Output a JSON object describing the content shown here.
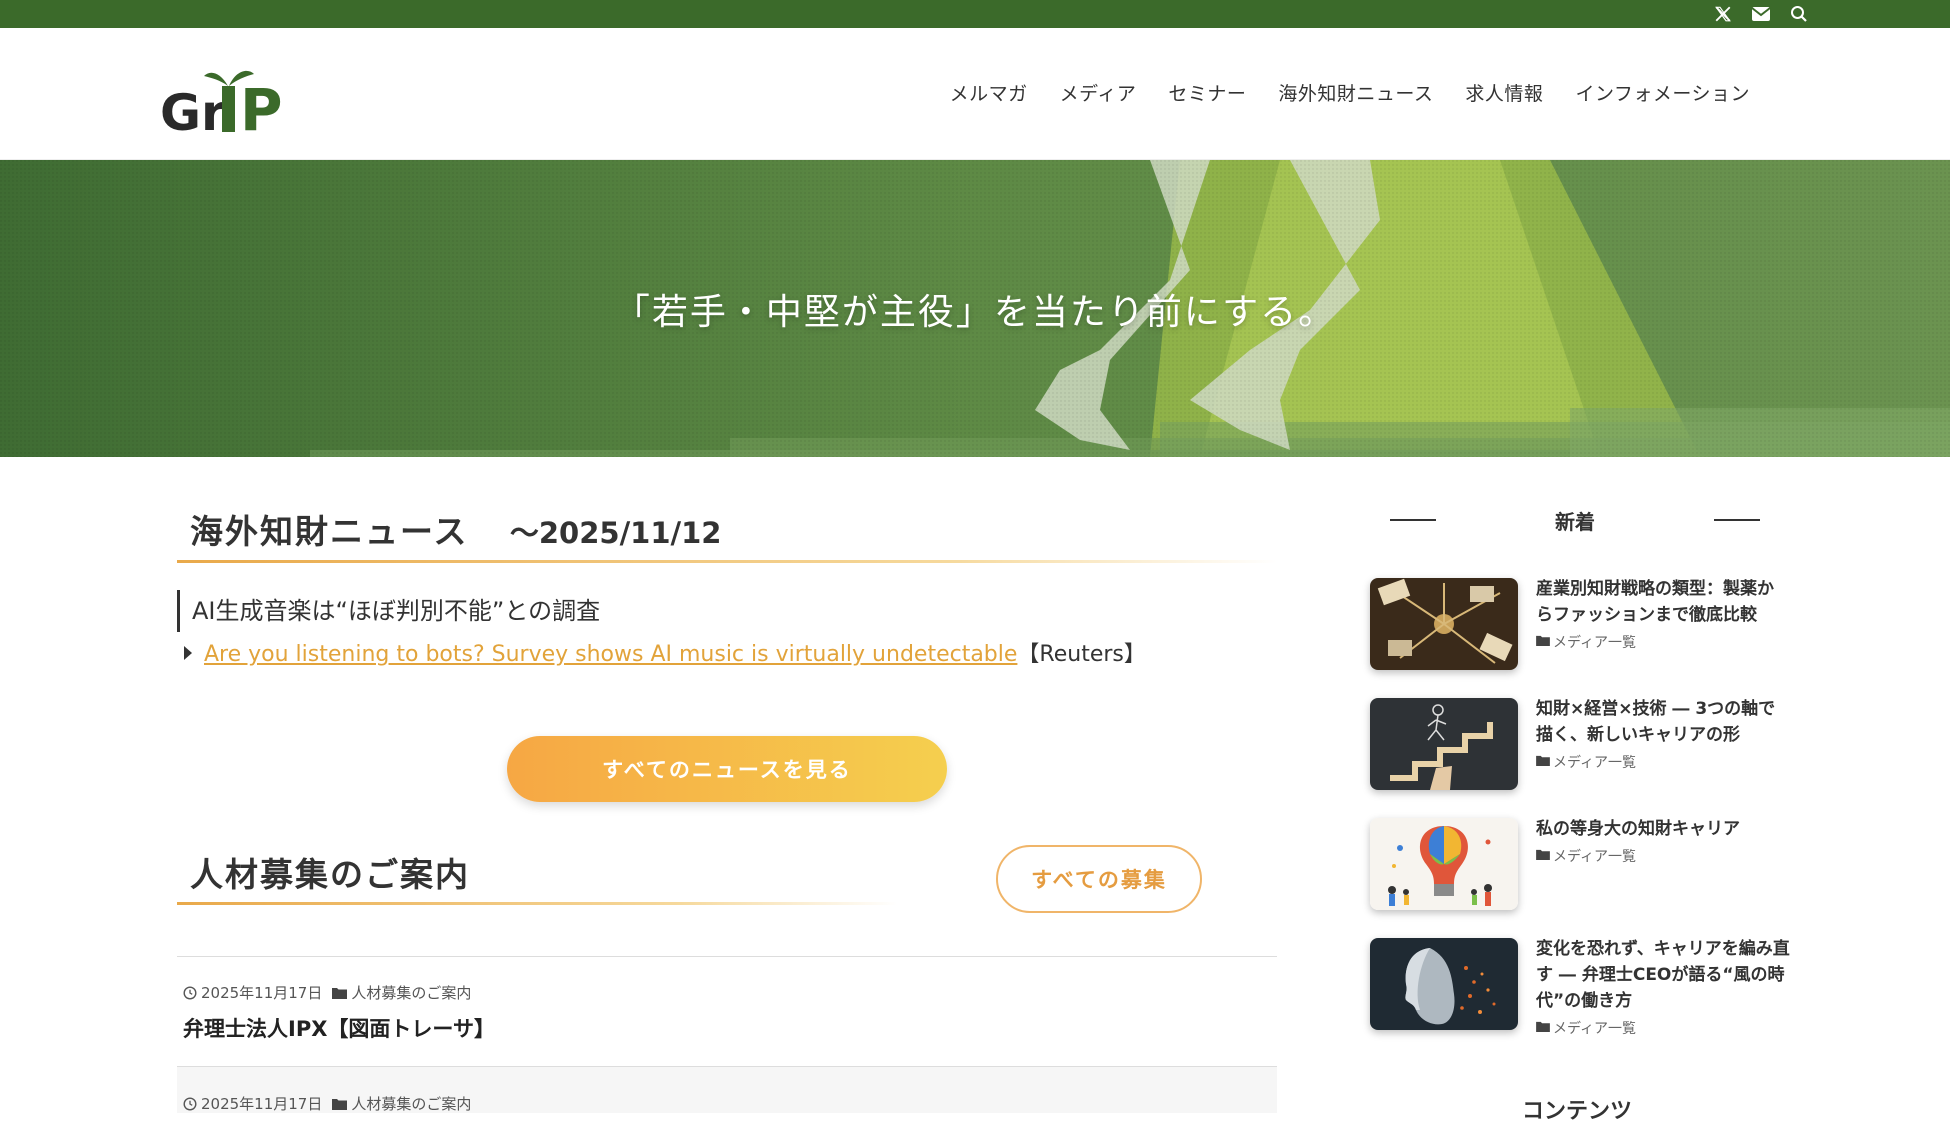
{
  "topbar": {
    "icons": [
      "x-icon",
      "mail-icon",
      "search-icon"
    ]
  },
  "header": {
    "logo_text": "GrIP",
    "nav": [
      "メルマガ",
      "メディア",
      "セミナー",
      "海外知財ニュース",
      "求人情報",
      "インフォメーション"
    ]
  },
  "hero": {
    "tagline": "「若手・中堅が主役」を当たり前にする。"
  },
  "news": {
    "heading": "海外知財ニュース",
    "date_suffix": "～2025/11/12",
    "item_title": "AI生成音楽は“ほぼ判別不能”との調査",
    "item_link": "Are you listening to bots? Survey shows AI music is virtually undetectable",
    "item_source": "【Reuters】",
    "all_button": "すべてのニュースを見る"
  },
  "jobs": {
    "heading": "人材募集のご案内",
    "all_button": "すべての募集",
    "posts": [
      {
        "date": "2025年11月17日",
        "category": "人材募集のご案内",
        "title": "弁理士法人IPX【図面トレーサ】"
      },
      {
        "date": "2025年11月17日",
        "category": "人材募集のご案内",
        "title": ""
      }
    ]
  },
  "sidebar": {
    "heading": "新着",
    "items": [
      {
        "title": "産業別知財戦略の類型：製薬からファッションまで徹底比較",
        "category": "メディア一覧"
      },
      {
        "title": "知財×経営×技術 ― 3つの軸で描く、新しいキャリアの形",
        "category": "メディア一覧"
      },
      {
        "title": "私の等身大の知財キャリア",
        "category": "メディア一覧"
      },
      {
        "title": "変化を恐れず、キャリアを編み直す ― 弁理士CEOが語る“風の時代”の働き方",
        "category": "メディア一覧"
      }
    ],
    "bottom_heading": "コンテンツ"
  },
  "colors": {
    "brand_green": "#3b6a2a",
    "accent_orange": "#f6a744",
    "link_orange": "#e2a33a"
  }
}
